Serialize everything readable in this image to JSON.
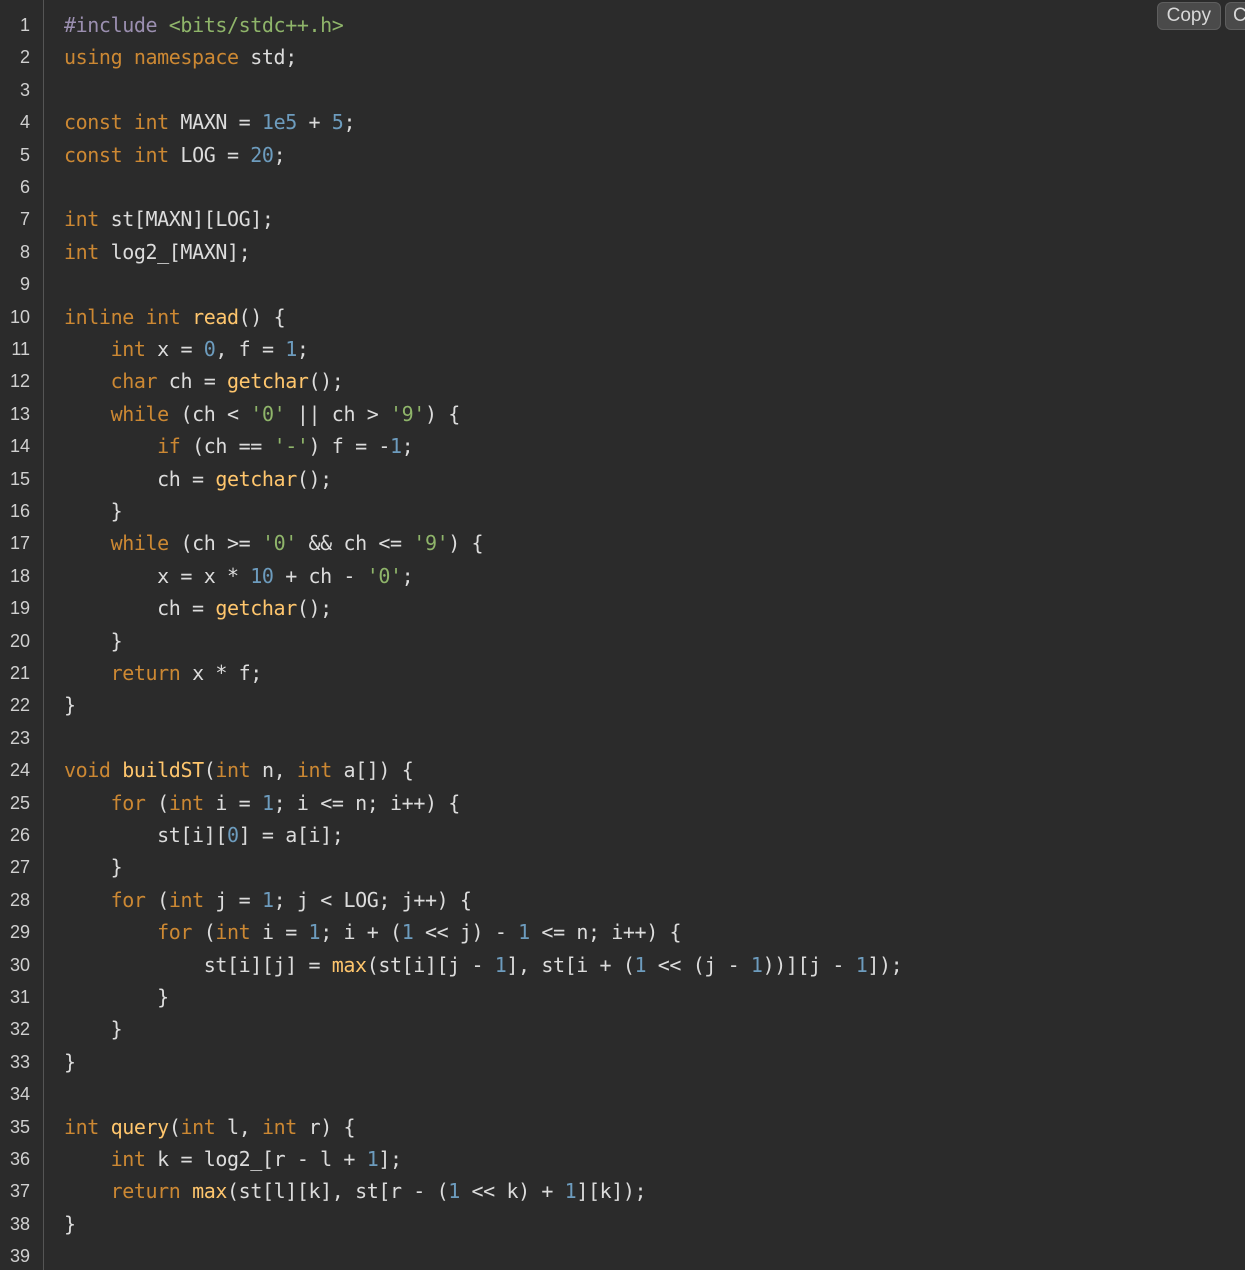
{
  "toolbar": {
    "copy_label": "Copy",
    "second_label": "C"
  },
  "lines": [
    {
      "n": "1",
      "t": [
        [
          "pp",
          "#include "
        ],
        [
          "inc",
          "<bits/stdc++.h>"
        ]
      ]
    },
    {
      "n": "2",
      "t": [
        [
          "kw",
          "using namespace"
        ],
        [
          "p",
          " std;"
        ]
      ]
    },
    {
      "n": "3",
      "t": []
    },
    {
      "n": "4",
      "t": [
        [
          "kw",
          "const int"
        ],
        [
          "p",
          " MAXN = "
        ],
        [
          "num",
          "1e5"
        ],
        [
          "p",
          " + "
        ],
        [
          "num",
          "5"
        ],
        [
          "p",
          ";"
        ]
      ]
    },
    {
      "n": "5",
      "t": [
        [
          "kw",
          "const int"
        ],
        [
          "p",
          " LOG = "
        ],
        [
          "num",
          "20"
        ],
        [
          "p",
          ";"
        ]
      ]
    },
    {
      "n": "6",
      "t": []
    },
    {
      "n": "7",
      "t": [
        [
          "kw",
          "int"
        ],
        [
          "p",
          " st[MAXN][LOG];"
        ]
      ]
    },
    {
      "n": "8",
      "t": [
        [
          "kw",
          "int"
        ],
        [
          "p",
          " log2_[MAXN];"
        ]
      ]
    },
    {
      "n": "9",
      "t": []
    },
    {
      "n": "10",
      "t": [
        [
          "kw",
          "inline int"
        ],
        [
          "p",
          " "
        ],
        [
          "fn",
          "read"
        ],
        [
          "p",
          "() {"
        ]
      ]
    },
    {
      "n": "11",
      "t": [
        [
          "p",
          "    "
        ],
        [
          "kw",
          "int"
        ],
        [
          "p",
          " x = "
        ],
        [
          "num",
          "0"
        ],
        [
          "p",
          ", f = "
        ],
        [
          "num",
          "1"
        ],
        [
          "p",
          ";"
        ]
      ]
    },
    {
      "n": "12",
      "t": [
        [
          "p",
          "    "
        ],
        [
          "kw",
          "char"
        ],
        [
          "p",
          " ch = "
        ],
        [
          "fn",
          "getchar"
        ],
        [
          "p",
          "();"
        ]
      ]
    },
    {
      "n": "13",
      "t": [
        [
          "p",
          "    "
        ],
        [
          "kw",
          "while"
        ],
        [
          "p",
          " (ch < "
        ],
        [
          "str",
          "'0'"
        ],
        [
          "p",
          " || ch > "
        ],
        [
          "str",
          "'9'"
        ],
        [
          "p",
          ") {"
        ]
      ]
    },
    {
      "n": "14",
      "t": [
        [
          "p",
          "        "
        ],
        [
          "kw",
          "if"
        ],
        [
          "p",
          " (ch == "
        ],
        [
          "str",
          "'-'"
        ],
        [
          "p",
          ") f = -"
        ],
        [
          "num",
          "1"
        ],
        [
          "p",
          ";"
        ]
      ]
    },
    {
      "n": "15",
      "t": [
        [
          "p",
          "        ch = "
        ],
        [
          "fn",
          "getchar"
        ],
        [
          "p",
          "();"
        ]
      ]
    },
    {
      "n": "16",
      "t": [
        [
          "p",
          "    }"
        ]
      ]
    },
    {
      "n": "17",
      "t": [
        [
          "p",
          "    "
        ],
        [
          "kw",
          "while"
        ],
        [
          "p",
          " (ch >= "
        ],
        [
          "str",
          "'0'"
        ],
        [
          "p",
          " && ch <= "
        ],
        [
          "str",
          "'9'"
        ],
        [
          "p",
          ") {"
        ]
      ]
    },
    {
      "n": "18",
      "t": [
        [
          "p",
          "        x = x * "
        ],
        [
          "num",
          "10"
        ],
        [
          "p",
          " + ch - "
        ],
        [
          "str",
          "'0'"
        ],
        [
          "p",
          ";"
        ]
      ]
    },
    {
      "n": "19",
      "t": [
        [
          "p",
          "        ch = "
        ],
        [
          "fn",
          "getchar"
        ],
        [
          "p",
          "();"
        ]
      ]
    },
    {
      "n": "20",
      "t": [
        [
          "p",
          "    }"
        ]
      ]
    },
    {
      "n": "21",
      "t": [
        [
          "p",
          "    "
        ],
        [
          "kw",
          "return"
        ],
        [
          "p",
          " x * f;"
        ]
      ]
    },
    {
      "n": "22",
      "t": [
        [
          "p",
          "}"
        ]
      ]
    },
    {
      "n": "23",
      "t": []
    },
    {
      "n": "24",
      "t": [
        [
          "kw",
          "void"
        ],
        [
          "p",
          " "
        ],
        [
          "fn",
          "buildST"
        ],
        [
          "p",
          "("
        ],
        [
          "kw",
          "int"
        ],
        [
          "p",
          " n, "
        ],
        [
          "kw",
          "int"
        ],
        [
          "p",
          " a[]) {"
        ]
      ]
    },
    {
      "n": "25",
      "t": [
        [
          "p",
          "    "
        ],
        [
          "kw",
          "for"
        ],
        [
          "p",
          " ("
        ],
        [
          "kw",
          "int"
        ],
        [
          "p",
          " i = "
        ],
        [
          "num",
          "1"
        ],
        [
          "p",
          "; i <= n; i++) {"
        ]
      ]
    },
    {
      "n": "26",
      "t": [
        [
          "p",
          "        st[i]["
        ],
        [
          "num",
          "0"
        ],
        [
          "p",
          "] = a[i];"
        ]
      ]
    },
    {
      "n": "27",
      "t": [
        [
          "p",
          "    }"
        ]
      ]
    },
    {
      "n": "28",
      "t": [
        [
          "p",
          "    "
        ],
        [
          "kw",
          "for"
        ],
        [
          "p",
          " ("
        ],
        [
          "kw",
          "int"
        ],
        [
          "p",
          " j = "
        ],
        [
          "num",
          "1"
        ],
        [
          "p",
          "; j < LOG; j++) {"
        ]
      ]
    },
    {
      "n": "29",
      "t": [
        [
          "p",
          "        "
        ],
        [
          "kw",
          "for"
        ],
        [
          "p",
          " ("
        ],
        [
          "kw",
          "int"
        ],
        [
          "p",
          " i = "
        ],
        [
          "num",
          "1"
        ],
        [
          "p",
          "; i + ("
        ],
        [
          "num",
          "1"
        ],
        [
          "p",
          " << j) - "
        ],
        [
          "num",
          "1"
        ],
        [
          "p",
          " <= n; i++) {"
        ]
      ]
    },
    {
      "n": "30",
      "t": [
        [
          "p",
          "            st[i][j] = "
        ],
        [
          "fn",
          "max"
        ],
        [
          "p",
          "(st[i][j - "
        ],
        [
          "num",
          "1"
        ],
        [
          "p",
          "], st[i + ("
        ],
        [
          "num",
          "1"
        ],
        [
          "p",
          " << (j - "
        ],
        [
          "num",
          "1"
        ],
        [
          "p",
          "))][j - "
        ],
        [
          "num",
          "1"
        ],
        [
          "p",
          "]);"
        ]
      ]
    },
    {
      "n": "31",
      "t": [
        [
          "p",
          "        }"
        ]
      ]
    },
    {
      "n": "32",
      "t": [
        [
          "p",
          "    }"
        ]
      ]
    },
    {
      "n": "33",
      "t": [
        [
          "p",
          "}"
        ]
      ]
    },
    {
      "n": "34",
      "t": []
    },
    {
      "n": "35",
      "t": [
        [
          "kw",
          "int"
        ],
        [
          "p",
          " "
        ],
        [
          "fn",
          "query"
        ],
        [
          "p",
          "("
        ],
        [
          "kw",
          "int"
        ],
        [
          "p",
          " l, "
        ],
        [
          "kw",
          "int"
        ],
        [
          "p",
          " r) {"
        ]
      ]
    },
    {
      "n": "36",
      "t": [
        [
          "p",
          "    "
        ],
        [
          "kw",
          "int"
        ],
        [
          "p",
          " k = log2_[r - l + "
        ],
        [
          "num",
          "1"
        ],
        [
          "p",
          "];"
        ]
      ]
    },
    {
      "n": "37",
      "t": [
        [
          "p",
          "    "
        ],
        [
          "kw",
          "return"
        ],
        [
          "p",
          " "
        ],
        [
          "fn",
          "max"
        ],
        [
          "p",
          "(st[l][k], st[r - ("
        ],
        [
          "num",
          "1"
        ],
        [
          "p",
          " << k) + "
        ],
        [
          "num",
          "1"
        ],
        [
          "p",
          "][k]);"
        ]
      ]
    },
    {
      "n": "38",
      "t": [
        [
          "p",
          "}"
        ]
      ]
    },
    {
      "n": "39",
      "t": []
    }
  ]
}
